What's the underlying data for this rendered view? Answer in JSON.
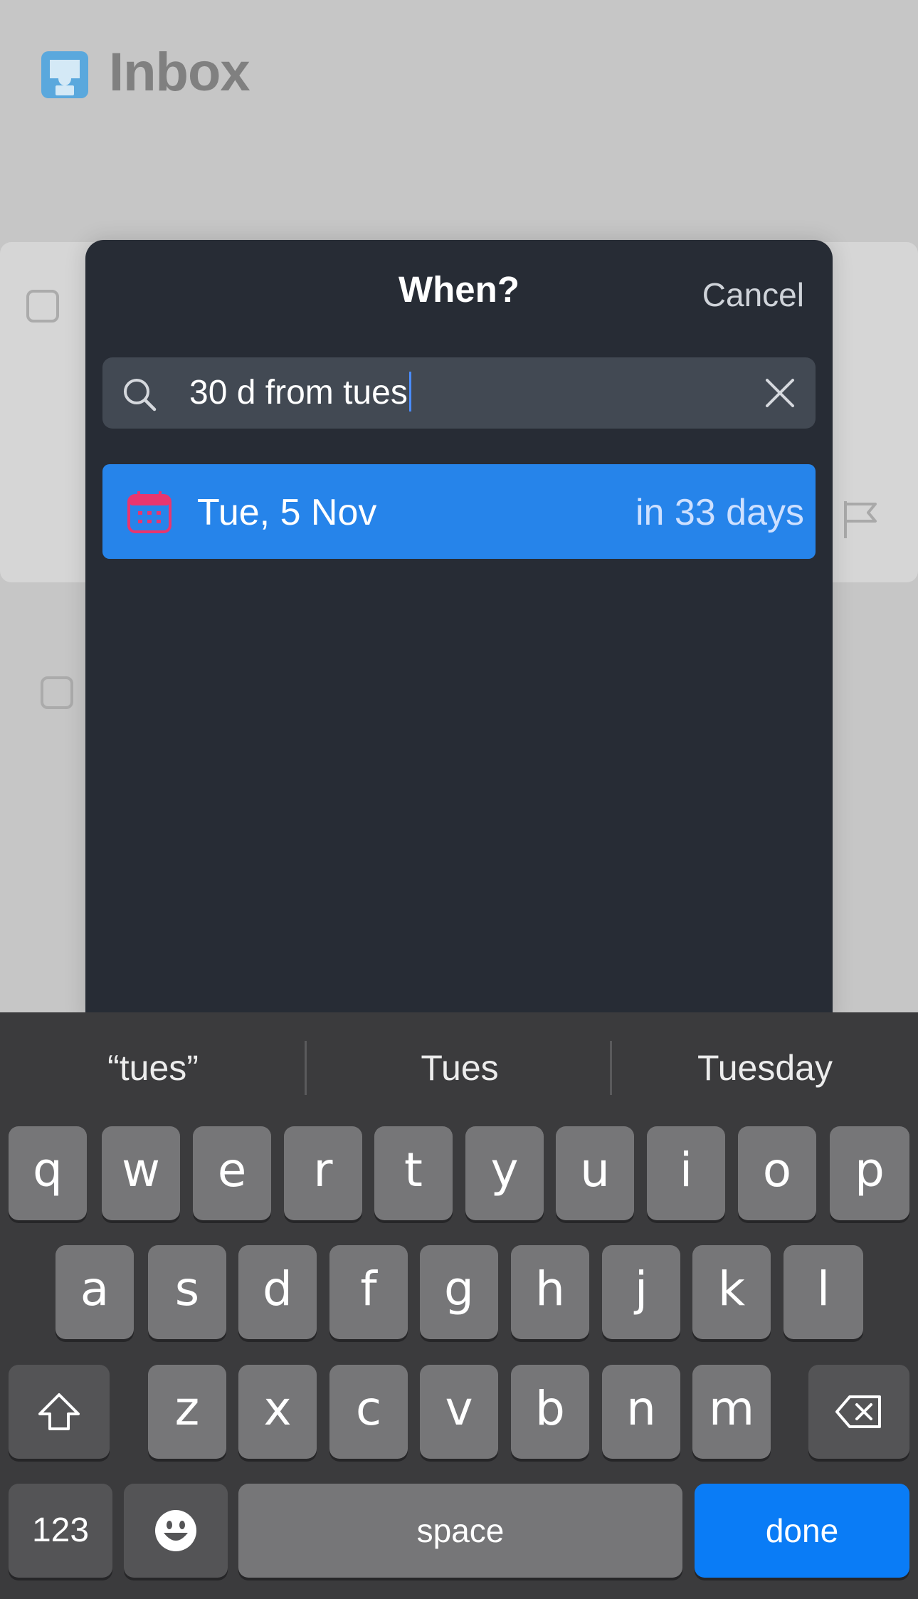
{
  "app": {
    "title": "Inbox"
  },
  "sheet": {
    "title": "When?",
    "cancel_label": "Cancel",
    "search": {
      "value": "30 d from tues"
    },
    "result": {
      "date": "Tue, 5 Nov",
      "relative": "in 33 days"
    }
  },
  "keyboard": {
    "suggestions": [
      "“tues”",
      "Tues",
      "Tuesday"
    ],
    "row1": [
      "q",
      "w",
      "e",
      "r",
      "t",
      "y",
      "u",
      "i",
      "o",
      "p"
    ],
    "row2": [
      "a",
      "s",
      "d",
      "f",
      "g",
      "h",
      "j",
      "k",
      "l"
    ],
    "row3": [
      "z",
      "x",
      "c",
      "v",
      "b",
      "n",
      "m"
    ],
    "numbers_label": "123",
    "space_label": "space",
    "done_label": "done"
  },
  "colors": {
    "sheet_bg": "#272c35",
    "accent": "#2684ea",
    "done_key": "#0a7cf6",
    "calendar_icon": "#e8366f",
    "inbox_icon": "#5aa8dd"
  },
  "icons": [
    "inbox-icon",
    "search-icon",
    "clear-icon",
    "calendar-icon",
    "flag-icon",
    "shift-icon",
    "backspace-icon",
    "emoji-icon"
  ]
}
